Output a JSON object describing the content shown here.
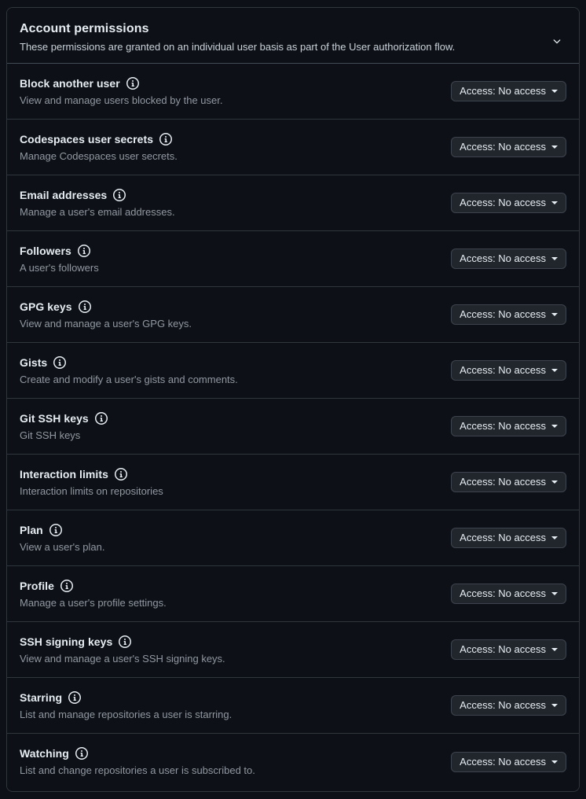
{
  "panel": {
    "header": {
      "title": "Account permissions",
      "subtitle": "These permissions are granted on an individual user basis as part of the User authorization flow.",
      "collapse_icon": "chevron-down-icon"
    },
    "row_info_icon": "info-icon",
    "access_caret_icon": "caret-down-icon",
    "colors": {
      "page_background": "#0d1117",
      "panel_background": "#0d1117",
      "panel_border": "#30363d",
      "header_divider": "#424a53",
      "row_divider": "#30363d",
      "title_text": "#e6edf3",
      "description_text": "#9198a1",
      "button_background": "#21262d",
      "button_border": "#3d444d"
    },
    "rows": [
      {
        "title": "Block another user",
        "description": "View and manage users blocked by the user.",
        "access_label": "Access: No access"
      },
      {
        "title": "Codespaces user secrets",
        "description": "Manage Codespaces user secrets.",
        "access_label": "Access: No access"
      },
      {
        "title": "Email addresses",
        "description": "Manage a user's email addresses.",
        "access_label": "Access: No access"
      },
      {
        "title": "Followers",
        "description": "A user's followers",
        "access_label": "Access: No access"
      },
      {
        "title": "GPG keys",
        "description": "View and manage a user's GPG keys.",
        "access_label": "Access: No access"
      },
      {
        "title": "Gists",
        "description": "Create and modify a user's gists and comments.",
        "access_label": "Access: No access"
      },
      {
        "title": "Git SSH keys",
        "description": "Git SSH keys",
        "access_label": "Access: No access"
      },
      {
        "title": "Interaction limits",
        "description": "Interaction limits on repositories",
        "access_label": "Access: No access"
      },
      {
        "title": "Plan",
        "description": "View a user's plan.",
        "access_label": "Access: No access"
      },
      {
        "title": "Profile",
        "description": "Manage a user's profile settings.",
        "access_label": "Access: No access"
      },
      {
        "title": "SSH signing keys",
        "description": "View and manage a user's SSH signing keys.",
        "access_label": "Access: No access"
      },
      {
        "title": "Starring",
        "description": "List and manage repositories a user is starring.",
        "access_label": "Access: No access"
      },
      {
        "title": "Watching",
        "description": "List and change repositories a user is subscribed to.",
        "access_label": "Access: No access"
      }
    ]
  }
}
